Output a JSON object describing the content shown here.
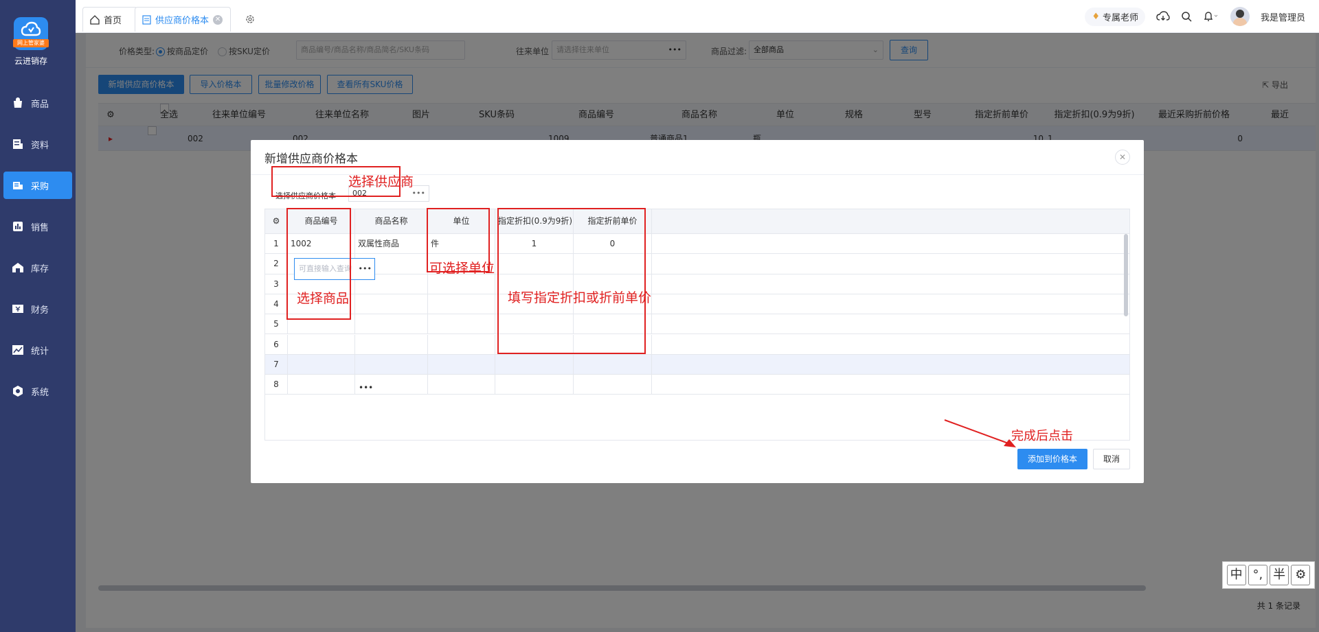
{
  "sidebar": {
    "logo_badge": "网上管家婆",
    "brand": "云进销存",
    "items": [
      {
        "label": "商品",
        "icon": "shopping-bag-icon"
      },
      {
        "label": "资料",
        "icon": "document-icon"
      },
      {
        "label": "采购",
        "icon": "purchase-icon"
      },
      {
        "label": "销售",
        "icon": "bar-chart-icon"
      },
      {
        "label": "库存",
        "icon": "warehouse-icon"
      },
      {
        "label": "财务",
        "icon": "yen-icon"
      },
      {
        "label": "统计",
        "icon": "trend-icon"
      },
      {
        "label": "系统",
        "icon": "hexagon-gear-icon"
      }
    ],
    "active_index": 2
  },
  "topbar": {
    "tabs": [
      {
        "label": "首页",
        "icon": "home-icon"
      },
      {
        "label": "供应商价格本",
        "icon": "document-icon"
      }
    ],
    "vip_label": "专属老师",
    "user_name": "我是管理员"
  },
  "filters": {
    "price_type_label": "价格类型:",
    "price_type_options": [
      "按商品定价",
      "按SKU定价"
    ],
    "search_placeholder": "商品编号/商品名称/商品简名/SKU条码",
    "partner_label": "往来单位",
    "partner_placeholder": "请选择往来单位",
    "product_filter_label": "商品过滤:",
    "product_filter_value": "全部商品",
    "query_button": "查询"
  },
  "actions": {
    "add": "新增供应商价格本",
    "import": "导入价格本",
    "batch_edit": "批量修改价格",
    "view_sku": "查看所有SKU价格",
    "export": "导出"
  },
  "bg_table": {
    "headers": [
      "全选",
      "往来单位编号",
      "往来单位名称",
      "图片",
      "SKU条码",
      "商品编号",
      "商品名称",
      "单位",
      "规格",
      "型号",
      "指定折前单价",
      "指定折扣(0.9为9折)",
      "最近采购折前价格",
      "最近"
    ],
    "row": {
      "partner_code": "002",
      "partner_name": "002",
      "product_code": "1009",
      "product_name": "普通商品1",
      "unit": "瓶",
      "price": "10",
      "discount": "1",
      "recent_price": "0"
    },
    "footer": "共 1 条记录"
  },
  "modal": {
    "title": "新增供应商价格本",
    "supplier_label": "选择供应商价格本",
    "supplier_value": "002",
    "grid_headers": [
      "商品编号",
      "商品名称",
      "单位",
      "指定折扣(0.9为9折)",
      "指定折前单价"
    ],
    "rows": [
      {
        "num": "1",
        "code": "1002",
        "name": "双属性商品",
        "unit": "件",
        "discount": "1",
        "price": "0"
      },
      {
        "num": "2",
        "code": "",
        "name": "",
        "unit": "",
        "discount": "",
        "price": ""
      },
      {
        "num": "3",
        "code": "",
        "name": "",
        "unit": "",
        "discount": "",
        "price": ""
      },
      {
        "num": "4",
        "code": "",
        "name": "",
        "unit": "",
        "discount": "",
        "price": ""
      },
      {
        "num": "5",
        "code": "",
        "name": "",
        "unit": "",
        "discount": "",
        "price": ""
      },
      {
        "num": "6",
        "code": "",
        "name": "",
        "unit": "",
        "discount": "",
        "price": ""
      },
      {
        "num": "7",
        "code": "",
        "name": "",
        "unit": "",
        "discount": "",
        "price": ""
      },
      {
        "num": "8",
        "code": "",
        "name": "",
        "unit": "",
        "discount": "",
        "price": ""
      }
    ],
    "input_placeholder": "可直接输入查询",
    "add_button": "添加到价格本",
    "cancel_button": "取消"
  },
  "annotations": {
    "supplier": "选择供应商",
    "product": "选择商品",
    "unit": "可选择单位",
    "discount": "填写指定折扣或折前单价",
    "finish": "完成后点击"
  },
  "ime": [
    "中",
    "°,",
    "半"
  ],
  "colors": {
    "accent": "#2d8cf0",
    "sidebar": "#2f3b6b",
    "annotation": "#e02020"
  }
}
